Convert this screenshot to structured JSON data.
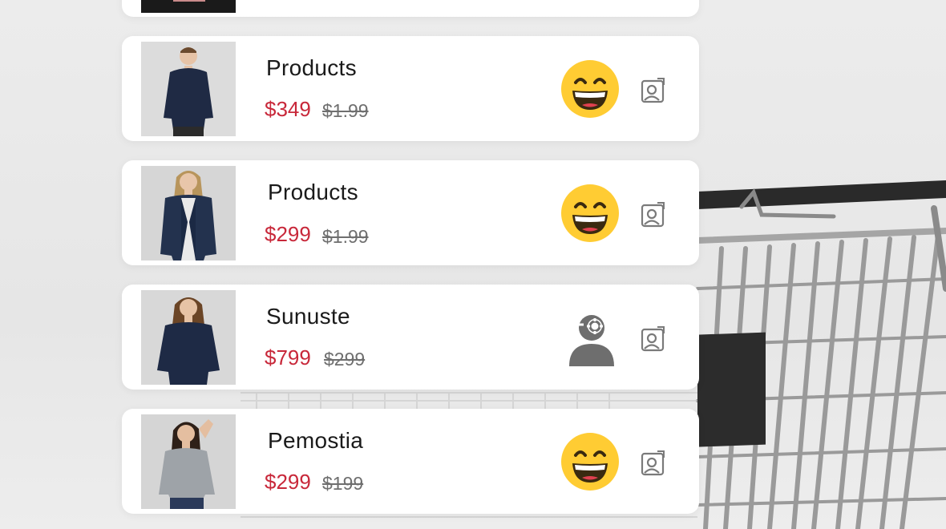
{
  "products": [
    {
      "name": "Products",
      "price": "$349",
      "old_price": "$1.99",
      "emoji": "grinning-face-icon"
    },
    {
      "name": "Products",
      "price": "$299",
      "old_price": "$1.99",
      "emoji": "grinning-face-icon"
    },
    {
      "name": "Sunuste",
      "price": "$799",
      "old_price": "$299",
      "emoji": "person-gear-icon"
    },
    {
      "name": "Pemostia",
      "price": "$299",
      "old_price": "$199",
      "emoji": "grinning-face-icon"
    }
  ],
  "colors": {
    "price": "#c8283a",
    "old_price": "#6f6f6f",
    "card": "#ffffff"
  }
}
